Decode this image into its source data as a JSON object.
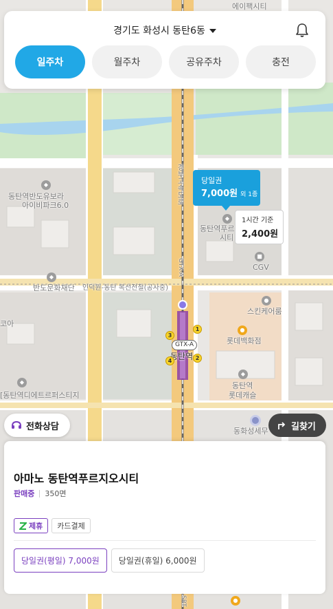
{
  "header": {
    "location": "경기도 화성시 동탄6동",
    "tabs": [
      {
        "label": "일주차",
        "active": true
      },
      {
        "label": "월주차",
        "active": false
      },
      {
        "label": "공유주차",
        "active": false
      },
      {
        "label": "충전",
        "active": false
      }
    ]
  },
  "map": {
    "labels": {
      "top_partial": "에이팩시티",
      "apt1_a": "동탄역반도유보라",
      "apt1_b": "아이비파크6.0",
      "road_vertical": "경부고속도로",
      "station_north": "동탄역푸르",
      "station_north_b": "시티",
      "cgv": "CGV",
      "gtx_a": "GTX-A",
      "bando": "반도문화재단",
      "construction": "인덕원-동탄 복선전철(공사중)",
      "skin": "스킨케어룸",
      "lotte_dept": "롯데백화점",
      "partial_left": "코아",
      "station": "동탄역",
      "gtx_badge": "GTX-A",
      "lotte_castle_a": "동탄역",
      "lotte_castle_b": "롯데캐슬",
      "ditpark": "[동탄역디에트르퍼스티지",
      "bottom_right": "동화성세무",
      "bottom_road": "SRT"
    },
    "exits": [
      "1",
      "2",
      "3",
      "4"
    ]
  },
  "markers": {
    "main": {
      "kind": "당일권",
      "price": "7,000원",
      "extra": "외 1종"
    },
    "sub": {
      "kind": "1시간 기준",
      "price": "2,400원"
    }
  },
  "buttons": {
    "consult": "전화상담",
    "route": "길찾기"
  },
  "sheet": {
    "name": "아마노 동탄역푸르지오시티",
    "status": "판매중",
    "spaces": "350면",
    "tags": [
      {
        "label": "제휴",
        "partner": true
      },
      {
        "label": "카드결제",
        "partner": false
      }
    ],
    "tickets": [
      {
        "label": "당일권(평일) 7,000원",
        "selected": true
      },
      {
        "label": "당일권(휴일) 6,000원",
        "selected": false
      }
    ]
  },
  "colors": {
    "accent": "#21a8e6",
    "purple": "#7a3fbf",
    "marker": "#1aa0dc"
  }
}
